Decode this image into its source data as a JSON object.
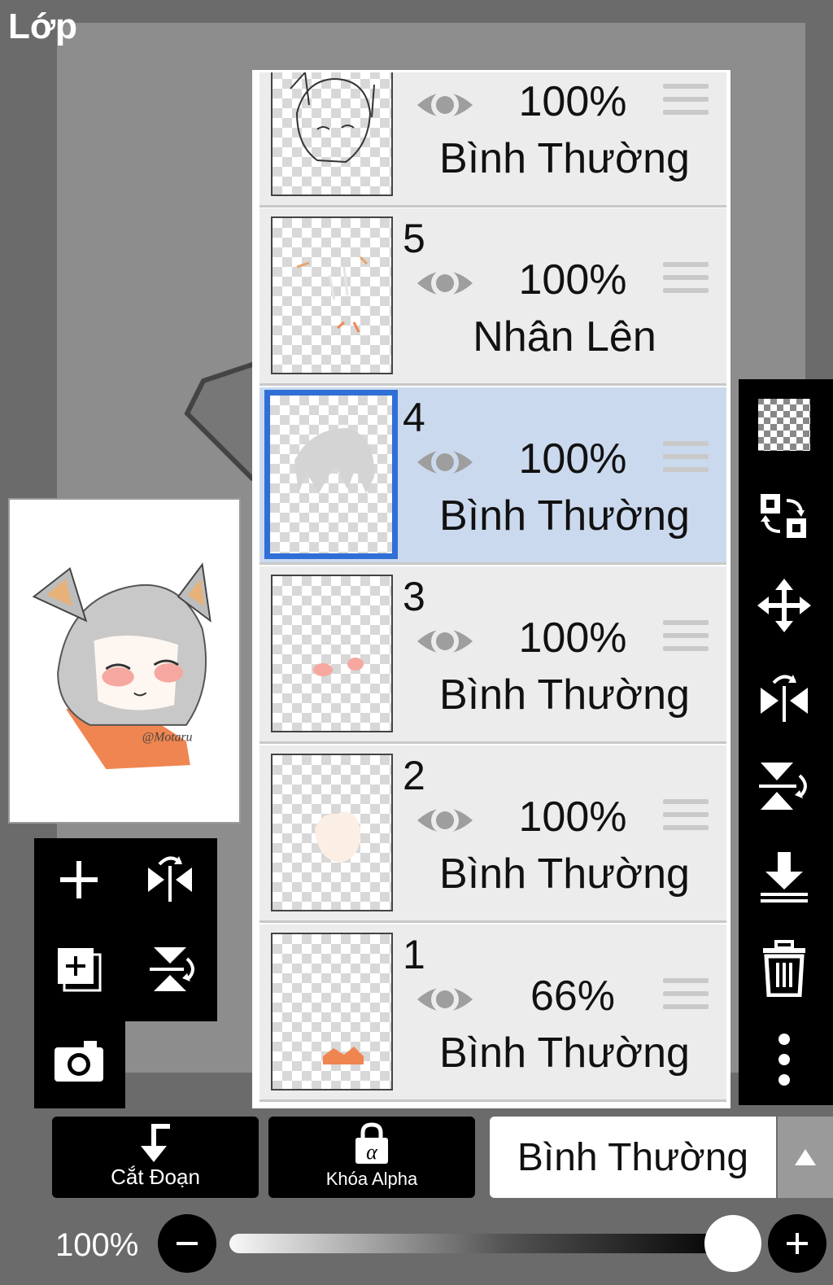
{
  "panel": {
    "title": "Lớp"
  },
  "layers": [
    {
      "number": "",
      "opacity": "100%",
      "blend": "Bình Thường",
      "selected": false
    },
    {
      "number": "5",
      "opacity": "100%",
      "blend": "Nhân Lên",
      "selected": false
    },
    {
      "number": "4",
      "opacity": "100%",
      "blend": "Bình Thường",
      "selected": true
    },
    {
      "number": "3",
      "opacity": "100%",
      "blend": "Bình Thường",
      "selected": false
    },
    {
      "number": "2",
      "opacity": "100%",
      "blend": "Bình Thường",
      "selected": false
    },
    {
      "number": "1",
      "opacity": "66%",
      "blend": "Bình Thường",
      "selected": false
    }
  ],
  "preview": {
    "watermark": "@Motaru"
  },
  "left_tools": [
    "add-layer",
    "flip-horizontal",
    "add-copy-layer",
    "flip-vertical",
    "camera"
  ],
  "right_tools": [
    "transparency",
    "swap",
    "move",
    "flip-horizontal",
    "flip-vertical",
    "merge-down",
    "delete",
    "more"
  ],
  "bottom": {
    "clip_label": "Cắt Đoạn",
    "alpha_lock_label": "Khóa Alpha",
    "blend_mode": "Bình Thường",
    "opacity_label": "100%",
    "opacity_value": 1.0
  },
  "colors": {
    "selected_row": "#cbd9ee",
    "selected_border": "#2f6fd6",
    "toolbar": "#000000",
    "background": "#6b6b6b"
  }
}
